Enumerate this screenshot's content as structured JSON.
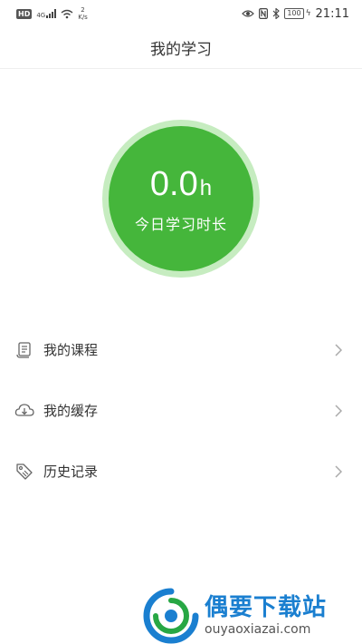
{
  "status_bar": {
    "hd": "HD",
    "network": "4G",
    "speed_value": "2",
    "speed_unit": "K/s",
    "battery": "100",
    "time": "21:11"
  },
  "header": {
    "title": "我的学习"
  },
  "study": {
    "value": "0.0",
    "unit": "h",
    "label": "今日学习时长"
  },
  "menu": {
    "items": [
      {
        "label": "我的课程",
        "icon": "course-scroll-icon"
      },
      {
        "label": "我的缓存",
        "icon": "cloud-download-icon"
      },
      {
        "label": "历史记录",
        "icon": "tag-history-icon"
      }
    ]
  },
  "watermark": {
    "name": "偶要下载站",
    "url": "ouyaoxiazai.com"
  },
  "colors": {
    "accent_green": "#45b63b",
    "ring_green": "#c6ecc0",
    "watermark_blue": "#1a7fd0"
  }
}
